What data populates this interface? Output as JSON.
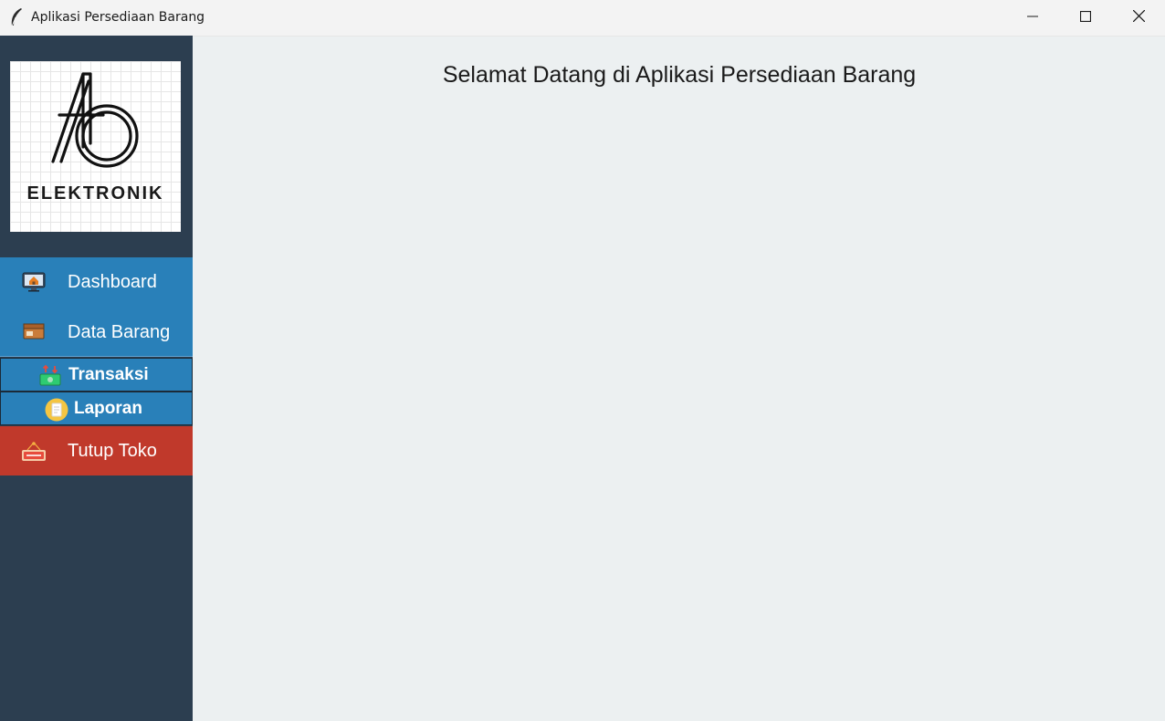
{
  "window": {
    "title": "Aplikasi Persediaan Barang",
    "app_icon": "feather-icon",
    "controls": [
      "minimize-icon",
      "maximize-icon",
      "close-icon"
    ]
  },
  "logo": {
    "monogram": "AB",
    "text": "ELEKTRONIK"
  },
  "sidebar": {
    "items": [
      {
        "label": "Dashboard",
        "icon": "monitor-home-icon"
      },
      {
        "label": "Data Barang",
        "icon": "box-icon"
      },
      {
        "label": "Transaksi",
        "icon": "money-transfer-icon"
      },
      {
        "label": "Laporan",
        "icon": "report-icon"
      },
      {
        "label": "Tutup Toko",
        "icon": "closed-sign-icon"
      }
    ]
  },
  "main": {
    "welcome_text": "Selamat Datang di Aplikasi Persediaan Barang"
  },
  "colors": {
    "sidebar_bg": "#2c3e50",
    "menu_bg": "#2980b9",
    "exit_bg": "#c0392b",
    "content_bg": "#ecf0f1"
  }
}
